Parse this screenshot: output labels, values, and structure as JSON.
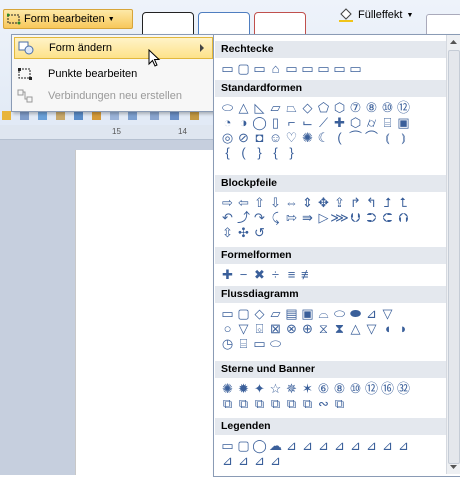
{
  "ribbon": {
    "form_edit_label": "Form bearbeiten",
    "fill_effect_label": "Fülleffekt"
  },
  "submenu": {
    "items": [
      {
        "label": "Form ändern"
      },
      {
        "label": "Punkte bearbeiten"
      },
      {
        "label": "Verbindungen neu erstellen"
      }
    ]
  },
  "ruler": {
    "marks": [
      "15",
      "14"
    ]
  },
  "gallery": {
    "categories": [
      {
        "title": "Rechtecke",
        "rows": [
          [
            "▭",
            "▢",
            "▭",
            "⌂",
            "▭",
            "▭",
            "▭",
            "▭",
            "▭"
          ]
        ]
      },
      {
        "title": "Standardformen",
        "rows": [
          [
            "⬭",
            "△",
            "◺",
            "▱",
            "⏢",
            "◇",
            "⬠",
            "⬡",
            "⑦",
            "⑧",
            "⑩",
            "⑫"
          ],
          [
            "◔",
            "◑",
            "◯",
            "▯",
            "⌐",
            "⌙",
            "⟋",
            "✚",
            "⬡",
            "⌭",
            "⌸",
            "▣"
          ],
          [
            "◎",
            "⊘",
            "◘",
            "☺",
            "♡",
            "✺",
            "☾",
            "(",
            "⏜",
            "⌒",
            "⦅",
            "⦆"
          ],
          [
            "{",
            "(",
            "}",
            "{",
            "}"
          ]
        ]
      },
      {
        "title": "Blockpfeile",
        "rows": [
          [
            "⇨",
            "⇦",
            "⇧",
            "⇩",
            "⇔",
            "⇕",
            "✥",
            "⇪",
            "↱",
            "↰",
            "⮥",
            "⮤"
          ],
          [
            "↶",
            "⤴",
            "↷",
            "⤹",
            "⇰",
            "⇛",
            "▷",
            "⋙",
            "⮋",
            "⮊",
            "⮈",
            "⮉"
          ],
          [
            "⇳",
            "✣",
            "↺"
          ]
        ]
      },
      {
        "title": "Formelformen",
        "rows": [
          [
            "✚",
            "−",
            "✖",
            "÷",
            "≡",
            "≢"
          ]
        ]
      },
      {
        "title": "Flussdiagramm",
        "rows": [
          [
            "▭",
            "▢",
            "◇",
            "▱",
            "▤",
            "▣",
            "⌓",
            "⬭",
            "⬬",
            "⊿",
            "▽"
          ],
          [
            "○",
            "▽",
            "⌺",
            "⊠",
            "⊗",
            "⊕",
            "⧖",
            "⧗",
            "△",
            "▽",
            "◖",
            "◗"
          ],
          [
            "◷",
            "⌸",
            "▭",
            "⬭"
          ]
        ]
      },
      {
        "title": "Sterne und Banner",
        "rows": [
          [
            "✺",
            "✹",
            "✦",
            "☆",
            "✵",
            "✶",
            "⑥",
            "⑧",
            "⑩",
            "⑫",
            "⑯",
            "㉜"
          ],
          [
            "⧉",
            "⧉",
            "⧉",
            "⧉",
            "⧉",
            "⧉",
            "∾",
            "⧉"
          ]
        ]
      },
      {
        "title": "Legenden",
        "rows": [
          [
            "▭",
            "▢",
            "◯",
            "☁",
            "⊿",
            "⊿",
            "⊿",
            "⊿",
            "⊿",
            "⊿",
            "⊿",
            "⊿"
          ],
          [
            "⊿",
            "⊿",
            "⊿",
            "⊿"
          ]
        ]
      }
    ]
  }
}
